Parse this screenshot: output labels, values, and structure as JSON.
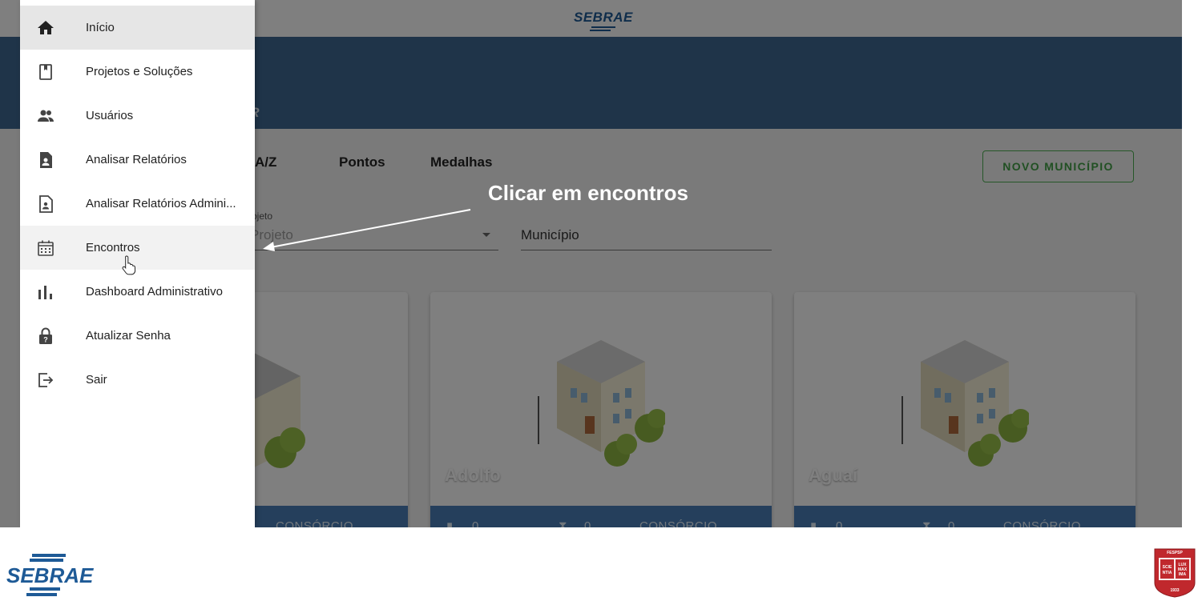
{
  "app": {
    "header_logo": "SEBRAE",
    "banner_title": "OR",
    "tabs": [
      {
        "label": "A/Z"
      },
      {
        "label": "Pontos"
      },
      {
        "label": "Medalhas"
      }
    ],
    "new_button": "NOVO MUNICÍPIO",
    "filters": {
      "project_label": "rojeto",
      "project_placeholder": "Projeto",
      "municipality_placeholder": "Município"
    },
    "cards": [
      {
        "name": "",
        "footer_a": "",
        "footer_b": "",
        "footer_c": "CONSÓRCIO"
      },
      {
        "name": "Adolfo",
        "footer_a": "0",
        "footer_b": "0",
        "footer_c": "CONSÓRCIO"
      },
      {
        "name": "Aguaí",
        "footer_a": "0",
        "footer_b": "0",
        "footer_c": "CONSÓRCIO"
      }
    ]
  },
  "drawer": {
    "items": [
      {
        "label": "Início",
        "icon": "home-icon"
      },
      {
        "label": "Projetos e Soluções",
        "icon": "book-icon"
      },
      {
        "label": "Usuários",
        "icon": "people-icon"
      },
      {
        "label": "Analisar Relatórios",
        "icon": "document-person-icon"
      },
      {
        "label": "Analisar Relatórios Admini...",
        "icon": "document-person-outline-icon"
      },
      {
        "label": "Encontros",
        "icon": "calendar-icon"
      },
      {
        "label": "Dashboard Administrativo",
        "icon": "bar-chart-icon"
      },
      {
        "label": "Atualizar Senha",
        "icon": "lock-question-icon"
      },
      {
        "label": "Sair",
        "icon": "logout-icon"
      }
    ]
  },
  "annotation": {
    "text": "Clicar em encontros"
  },
  "footer": {
    "left_logo": "SEBRAE",
    "seal_top": "FESPSP",
    "seal_left": "SCIE NTIA",
    "seal_right": "LUX MAX IMA",
    "seal_year": "1933"
  },
  "colors": {
    "banner": "#3f6893",
    "card_footer": "#4a7fb8",
    "accent_green": "#43a047",
    "brand_blue": "#1e5a96",
    "seal_red": "#c0282d"
  }
}
